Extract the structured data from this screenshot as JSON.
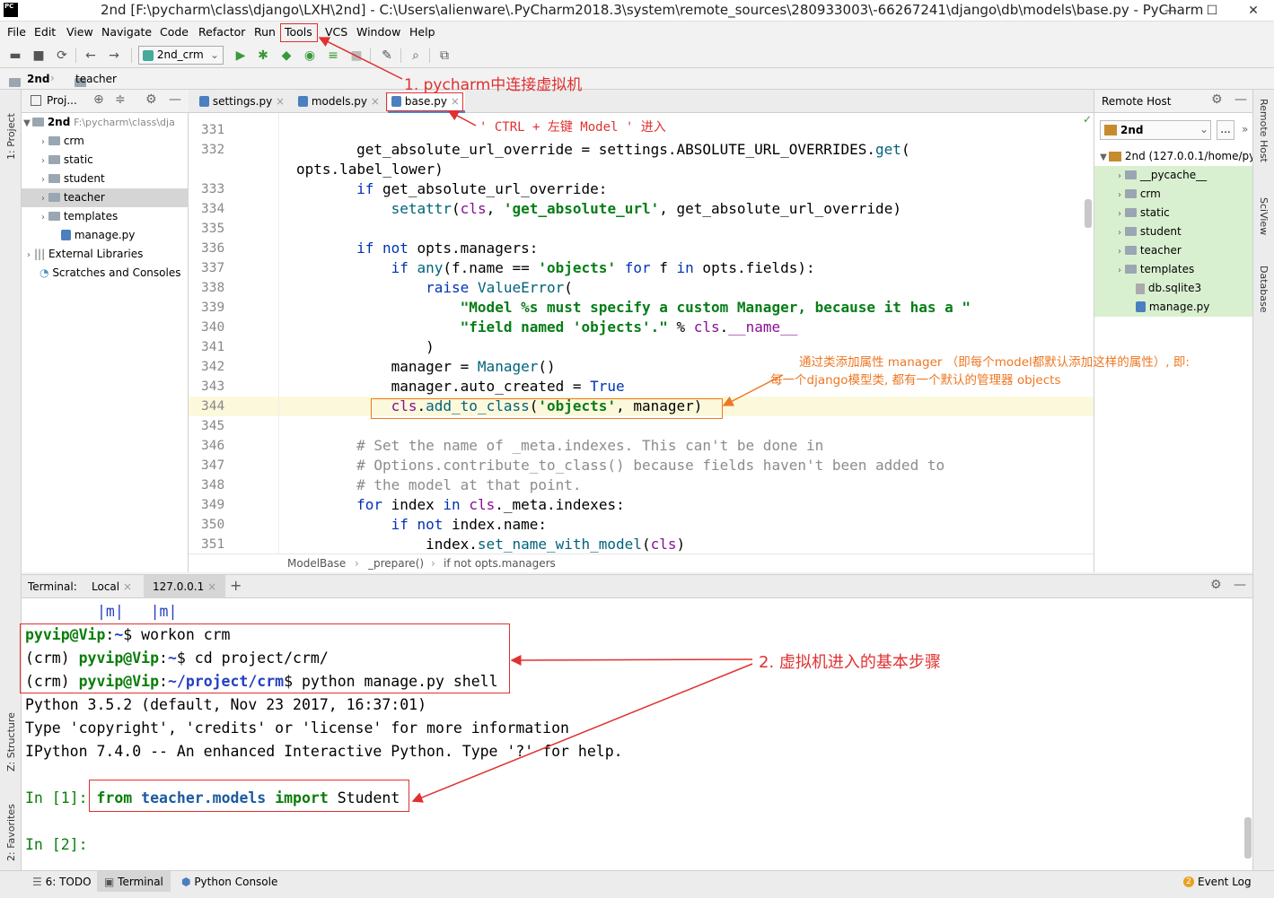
{
  "window": {
    "title": "2nd [F:\\pycharm\\class\\django\\LXH\\2nd] - C:\\Users\\alienware\\.PyCharm2018.3\\system\\remote_sources\\280933003\\-66267241\\django\\db\\models\\base.py - PyCharm",
    "logo": "PC",
    "min": "—",
    "max": "☐",
    "close": "✕"
  },
  "menu": [
    "File",
    "Edit",
    "View",
    "Navigate",
    "Code",
    "Refactor",
    "Run",
    "Tools",
    "VCS",
    "Window",
    "Help"
  ],
  "toolbar": {
    "run_config": "2nd_crm"
  },
  "nav": {
    "project": "2nd",
    "folder": "teacher"
  },
  "project_panel": {
    "header": "Proj...",
    "root_label": "2nd",
    "root_path": "F:\\pycharm\\class\\dja",
    "items": [
      "crm",
      "static",
      "student",
      "teacher",
      "templates",
      "manage.py",
      "External Libraries",
      "Scratches and Consoles"
    ]
  },
  "editor_tabs": [
    "settings.py",
    "models.py",
    "base.py"
  ],
  "code_lines": [
    {
      "n": "331",
      "t": ""
    },
    {
      "n": "332",
      "t": "        get_absolute_url_override = settings.ABSOLUTE_URL_OVERRIDES.get("
    },
    {
      "n": "",
      "t": "opts.label_lower)"
    },
    {
      "n": "333",
      "t": "        if get_absolute_url_override:"
    },
    {
      "n": "334",
      "t": "            setattr(cls, 'get_absolute_url', get_absolute_url_override)"
    },
    {
      "n": "335",
      "t": ""
    },
    {
      "n": "336",
      "t": "        if not opts.managers:"
    },
    {
      "n": "337",
      "t": "            if any(f.name == 'objects' for f in opts.fields):"
    },
    {
      "n": "338",
      "t": "                raise ValueError("
    },
    {
      "n": "339",
      "t": "                    \"Model %s must specify a custom Manager, because it has a \""
    },
    {
      "n": "340",
      "t": "                    \"field named 'objects'.\" % cls.__name__"
    },
    {
      "n": "341",
      "t": "                )"
    },
    {
      "n": "342",
      "t": "            manager = Manager()"
    },
    {
      "n": "343",
      "t": "            manager.auto_created = True"
    },
    {
      "n": "344",
      "t": "            cls.add_to_class('objects', manager)"
    },
    {
      "n": "345",
      "t": ""
    },
    {
      "n": "346",
      "t": "        # Set the name of _meta.indexes. This can't be done in"
    },
    {
      "n": "347",
      "t": "        # Options.contribute_to_class() because fields haven't been added to"
    },
    {
      "n": "348",
      "t": "        # the model at that point."
    },
    {
      "n": "349",
      "t": "        for index in cls._meta.indexes:"
    },
    {
      "n": "350",
      "t": "            if not index.name:"
    },
    {
      "n": "351",
      "t": "                index.set_name_with_model(cls)"
    }
  ],
  "breadcrumbs": [
    "ModelBase",
    "_prepare()",
    "if not opts.managers"
  ],
  "remote_host": {
    "title": "Remote Host",
    "server": "2nd",
    "root": "2nd (127.0.0.1/home/py",
    "items": [
      "__pycache__",
      "crm",
      "static",
      "student",
      "teacher",
      "templates",
      "db.sqlite3",
      "manage.py"
    ]
  },
  "right_strip": [
    "Remote Host",
    "SciView",
    "Database"
  ],
  "left_strip": [
    "1: Project",
    "Z: Structure",
    "2: Favorites"
  ],
  "terminal": {
    "label": "Terminal:",
    "tabs": [
      "Local",
      "127.0.0.1"
    ],
    "add": "+",
    "top_line": "|m|   |m|",
    "prompt_user": "pyvip@Vip",
    "cmd1": "workon crm",
    "cmd2": "cd project/crm/",
    "path3": "~/project/crm",
    "cmd3": "python manage.py shell",
    "env": "(crm)",
    "out1": "Python 3.5.2 (default, Nov 23 2017, 16:37:01)",
    "out2": "Type 'copyright', 'credits' or 'license' for more information",
    "out3": "IPython 7.4.0 -- An enhanced Interactive Python. Type '?' for help.",
    "in1": "In [1]:",
    "in1_code_kw1": "from",
    "in1_code_mod": "teacher.models",
    "in1_code_kw2": "import",
    "in1_code_name": "Student",
    "in2": "In [2]:"
  },
  "bottom_tabs": [
    "6: TODO",
    "Terminal",
    "Python Console"
  ],
  "event_log": {
    "count": "2",
    "label": "Event Log"
  },
  "annotations": {
    "a1": "1. pycharm中连接虚拟机",
    "a2": "' CTRL + 左键 Model '   进入",
    "a3_line1": "通过类添加属性 manager （即每个model都默认添加这样的属性）, 即:",
    "a3_line2": "每一个django模型类, 都有一个默认的管理器 objects",
    "a4": "2. 虚拟机进入的基本步骤"
  }
}
